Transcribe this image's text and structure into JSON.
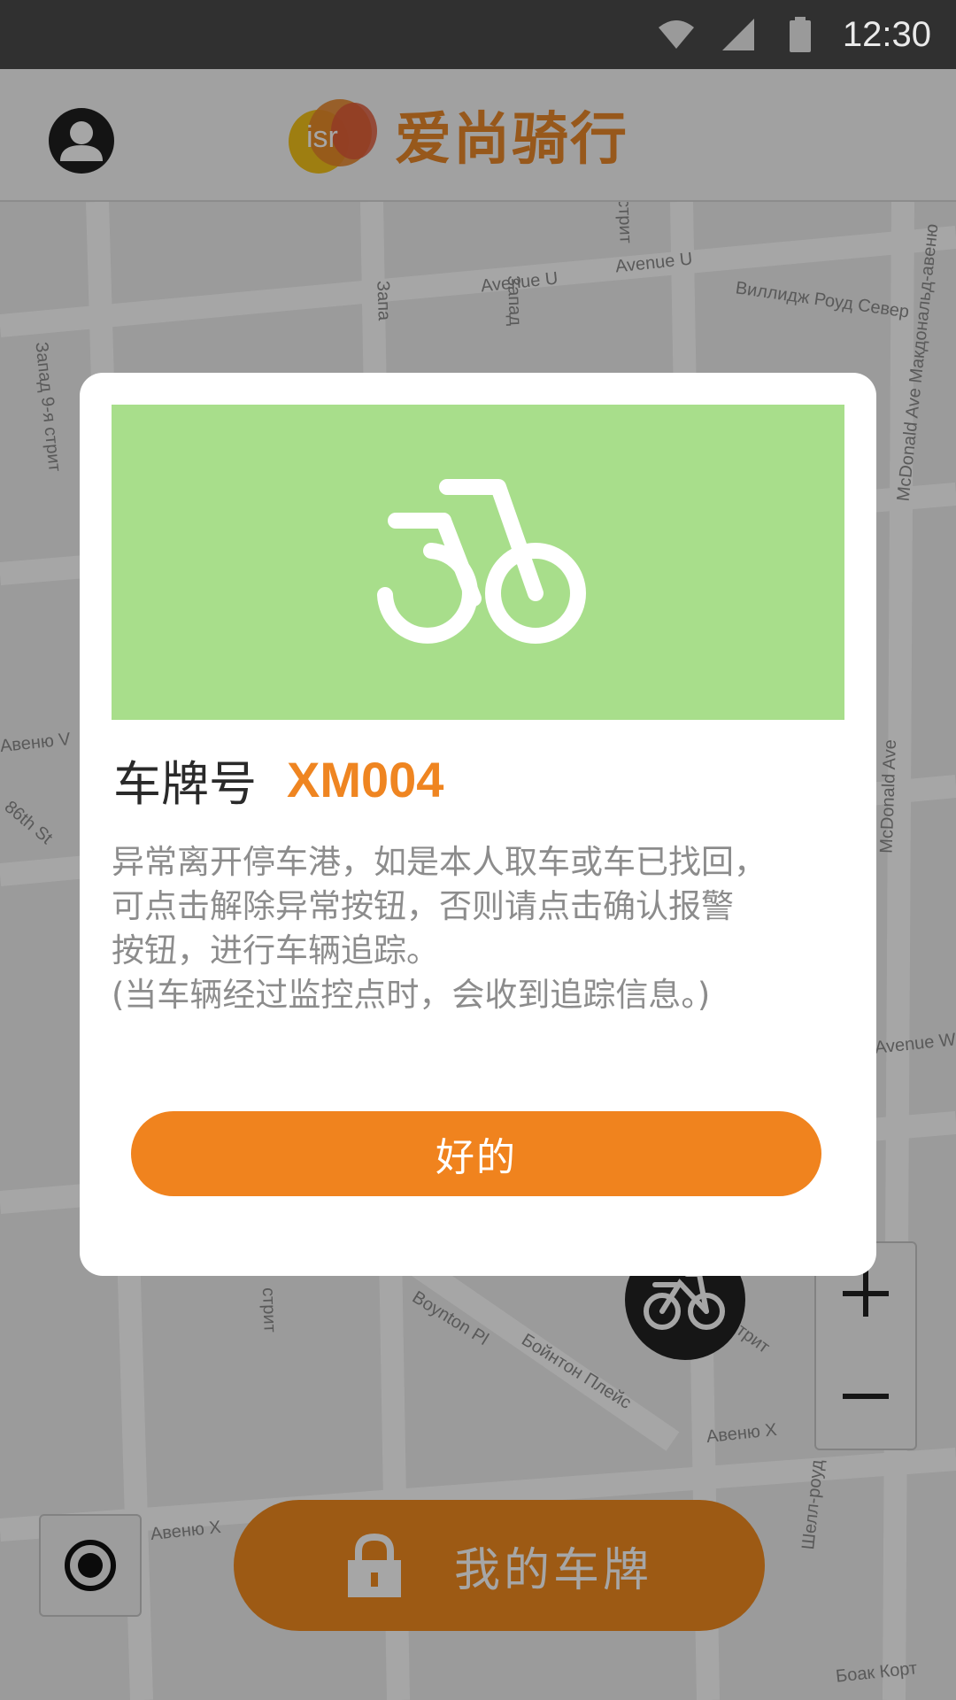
{
  "status_bar": {
    "time": "12:30",
    "icons": [
      "wifi-icon",
      "signal-icon",
      "battery-icon"
    ]
  },
  "header": {
    "logo_badge": "isr",
    "app_name": "爱尚骑行",
    "avatar_icon": "user-icon"
  },
  "map": {
    "labels": [
      "Avenue U",
      "Avenue U",
      "Виллидж Роуд Север",
      "McDonald Ave Макдональд-авеню",
      "McDonald Ave",
      "Avenue W",
      "86th St",
      "Boynton Pl",
      "Бойнтон Плейс",
      "Авеню X",
      "Авеню X",
      "Шелл-роуд",
      "Боак Корт",
      "стрит",
      "Запад",
      "Запа",
      "стрит",
      "Авеню V",
      "Запад 9-я стрит",
      "9-я стрит"
    ]
  },
  "dialog": {
    "plate_label": "车牌号",
    "plate_number": "XM004",
    "message_lines": [
      "异常离开停车港，如是本人取车或车已找回，",
      "可点击解除异常按钮，否则请点击确认报警",
      "按钮，进行车辆追踪。",
      "(当车辆经过监控点时，会收到追踪信息。)"
    ],
    "ok_label": "好的"
  },
  "controls": {
    "my_plate_label": "我的车牌",
    "zoom_in": "+",
    "zoom_out": "−"
  },
  "colors": {
    "accent": "#F0831E",
    "banner_green": "#A8DE8B",
    "status_bar": "#303030"
  }
}
